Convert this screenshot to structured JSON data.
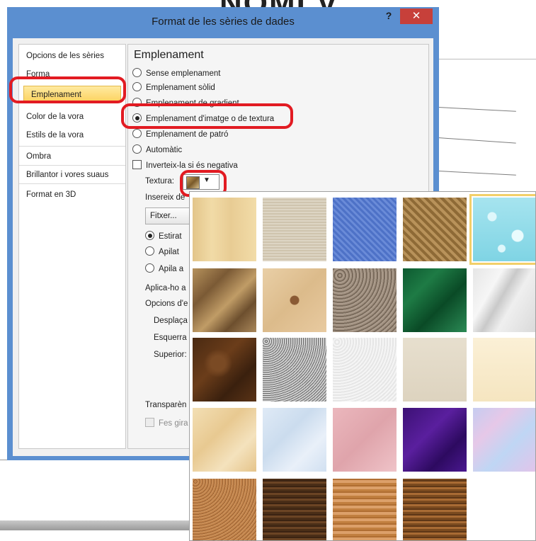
{
  "background": {
    "heading_fragment": "NOMI V"
  },
  "dialog": {
    "title": "Format de les sèries de dades",
    "help_label": "?",
    "close_label": "✕"
  },
  "nav": {
    "items": [
      "Opcions de les sèries",
      "Forma",
      "Emplenament",
      "Color de la vora",
      "Estils de la vora",
      "Ombra",
      "Brillantor i vores suaus",
      "Format en 3D"
    ],
    "selected_index": 2
  },
  "panel": {
    "title": "Emplenament",
    "fill_options": [
      "Sense emplenament",
      "Emplenament sòlid",
      "Emplenament de gradient",
      "Emplenament d'imatge o de textura",
      "Emplenament de patró",
      "Automàtic"
    ],
    "selected_fill_index": 3,
    "invert_negative": "Inverteix-la si és negativa",
    "texture_label": "Textura:",
    "insert_from_label": "Insereix de",
    "file_button": "Fitxer...",
    "layout_options": [
      "Estirat",
      "Apilat",
      "Apila a"
    ],
    "apply_to_label": "Aplica-ho a",
    "offset_options_label": "Opcions d'e",
    "offset_left_label": "Desplaça",
    "left_label": "Esquerra",
    "top_label": "Superior:",
    "transparency_label": "Transparèn",
    "rotate_label": "Fes gira"
  },
  "gallery": {
    "selected_index": 4,
    "textures": [
      "papyrus",
      "canvas",
      "denim",
      "woven-mat",
      "water-droplets",
      "brown-paper-bag",
      "fish-fossil",
      "sand",
      "green-marble",
      "white-marble",
      "brown-marble",
      "granite",
      "white-paper",
      "stationery",
      "cream-paper",
      "parchment",
      "blue-tissue",
      "pink-tissue",
      "purple-mesh",
      "bouquet",
      "cork",
      "walnut",
      "oak",
      "medium-wood"
    ]
  },
  "colors": {
    "accent": "#5b8fd0",
    "close": "#c7403a",
    "annotation": "#e21b22",
    "selection": "#fcd25e"
  }
}
